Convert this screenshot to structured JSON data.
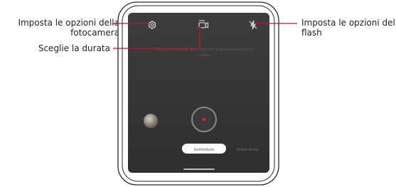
{
  "callouts": {
    "camera_settings": [
      "Imposta le opzioni della",
      "fotocamera"
    ],
    "duration": "Sceglie la durata",
    "flash": [
      "Imposta le opzioni del",
      "flash"
    ]
  },
  "screen": {
    "hint_line1": "Toccare e tenere premuto per registrare un video",
    "hint_line2": "video",
    "mode_selected": "Sottotitolo",
    "mode_other": "Video lento"
  },
  "colors": {
    "screen_dark": "#383838",
    "callout_red": "#c8102e",
    "record_red": "#e5202e",
    "device_outline": "#2a2a2a"
  }
}
